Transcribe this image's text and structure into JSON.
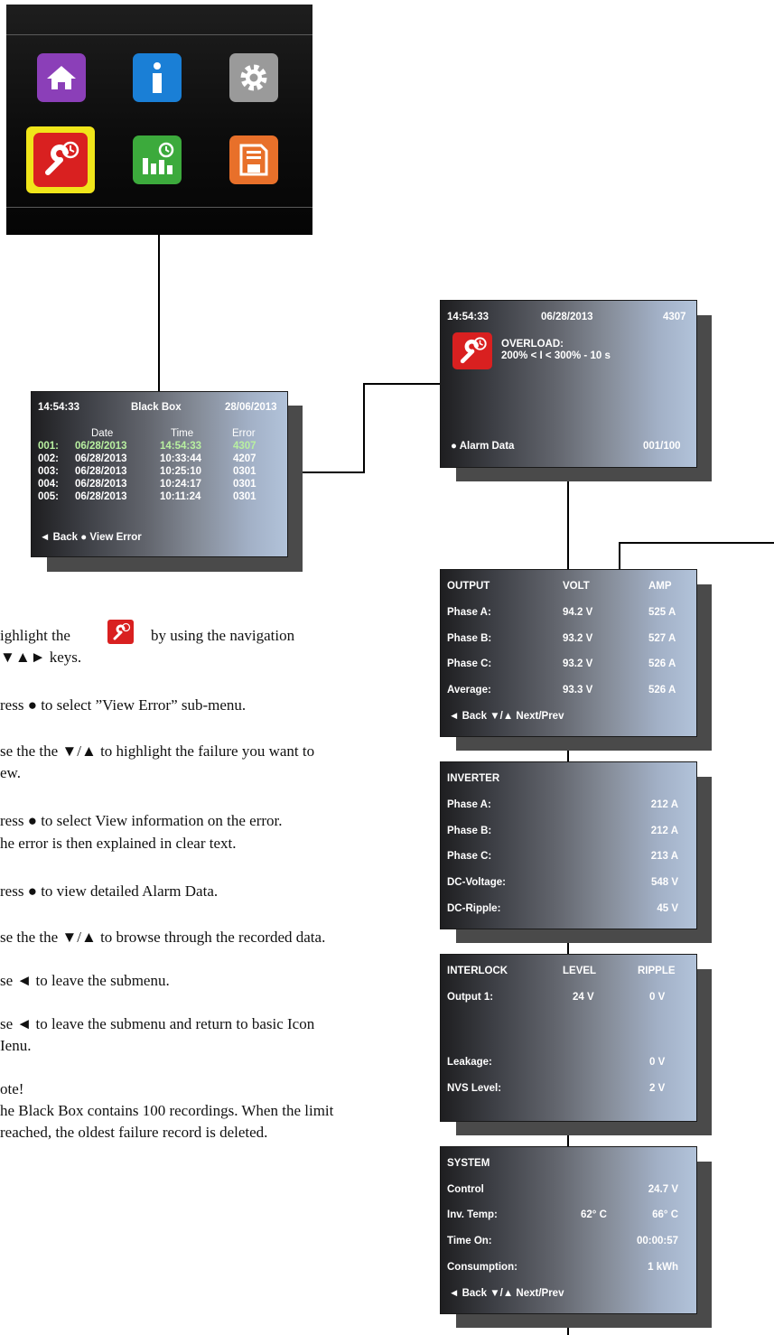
{
  "icon_menu": {
    "tiles": [
      {
        "name": "home-icon",
        "color": "#8b3fb8"
      },
      {
        "name": "info-icon",
        "color": "#1a7fd6"
      },
      {
        "name": "settings-icon",
        "color": "#9a9a9a"
      },
      {
        "name": "service-wrench-icon",
        "color": "#d92020",
        "selected": true
      },
      {
        "name": "statistics-icon",
        "color": "#3caa3c"
      },
      {
        "name": "save-icon",
        "color": "#e8702a"
      }
    ]
  },
  "black_box": {
    "time": "14:54:33",
    "title": "Black Box",
    "date": "28/06/2013",
    "col_date": "Date",
    "col_time": "Time",
    "col_error": "Error",
    "rows": [
      {
        "idx": "001:",
        "date": "06/28/2013",
        "time": "14:54:33",
        "error": "4307"
      },
      {
        "idx": "002:",
        "date": "06/28/2013",
        "time": "10:33:44",
        "error": "4207"
      },
      {
        "idx": "003:",
        "date": "06/28/2013",
        "time": "10:25:10",
        "error": "0301"
      },
      {
        "idx": "004:",
        "date": "06/28/2013",
        "time": "10:24:17",
        "error": "0301"
      },
      {
        "idx": "005:",
        "date": "06/28/2013",
        "time": "10:11:24",
        "error": "0301"
      }
    ],
    "footer": "◄ Back  ● View Error"
  },
  "error_detail": {
    "time": "14:54:33",
    "date": "06/28/2013",
    "code": "4307",
    "line1": "OVERLOAD:",
    "line2": "200% < I < 300% - 10 s",
    "footer_left": "● Alarm Data",
    "footer_right": "001/100"
  },
  "output": {
    "h1": "OUTPUT",
    "h2": "VOLT",
    "h3": "AMP",
    "rows": [
      {
        "label": "Phase A:",
        "volt": "94.2 V",
        "amp": "525 A"
      },
      {
        "label": "Phase B:",
        "volt": "93.2 V",
        "amp": "527 A"
      },
      {
        "label": "Phase C:",
        "volt": "93.2 V",
        "amp": "526 A"
      },
      {
        "label": "Average:",
        "volt": "93.3 V",
        "amp": "526 A"
      }
    ],
    "footer": "◄ Back  ▼/▲  Next/Prev"
  },
  "inverter": {
    "h1": "INVERTER",
    "rows": [
      {
        "label": "Phase A:",
        "value": "212 A"
      },
      {
        "label": "Phase B:",
        "value": "212 A"
      },
      {
        "label": "Phase C:",
        "value": "213 A"
      },
      {
        "label": "DC-Voltage:",
        "value": "548 V"
      },
      {
        "label": "DC-Ripple:",
        "value": "45 V"
      }
    ]
  },
  "interlock": {
    "h1": "INTERLOCK",
    "h2": "LEVEL",
    "h3": "RIPPLE",
    "output1_label": "Output 1:",
    "output1_level": "24 V",
    "output1_ripple": "0 V",
    "leakage_label": "Leakage:",
    "leakage_ripple": "0 V",
    "nvs_label": "NVS Level:",
    "nvs_ripple": "2 V"
  },
  "system": {
    "h1": "SYSTEM",
    "control_label": "Control",
    "control_value": "24.7 V",
    "temp_label": "Inv. Temp:",
    "temp_1": "62° C",
    "temp_2": "66° C",
    "timeon_label": "Time On:",
    "timeon_value": "00:00:57",
    "cons_label": "Consumption:",
    "cons_value": "1 kWh",
    "footer": "◄ Back  ▼/▲  Next/Prev"
  },
  "instructions": [
    {
      "a": "ighlight  the",
      "b": "by using the navigation",
      "c": "▼▲► keys."
    },
    {
      "a": "ress ● to select ”View Error” sub-menu."
    },
    {
      "a": "se the the ▼/▲ to highlight the failure you want to",
      "b": "ew."
    },
    {
      "a": "ress ● to select View information on the error.",
      "b": "he error is then explained in clear text."
    },
    {
      "a": "ress ● to view detailed Alarm Data."
    },
    {
      "a": "se the the ▼/▲ to browse through the recorded data."
    },
    {
      "a": "se ◄ to leave the submenu."
    },
    {
      "a": "se ◄ to leave the submenu and return to basic Icon",
      "b": "Ienu."
    },
    {
      "a": "ote!",
      "b": "he Black Box contains 100 recordings. When the limit",
      "c": " reached, the oldest failure record is deleted."
    }
  ]
}
